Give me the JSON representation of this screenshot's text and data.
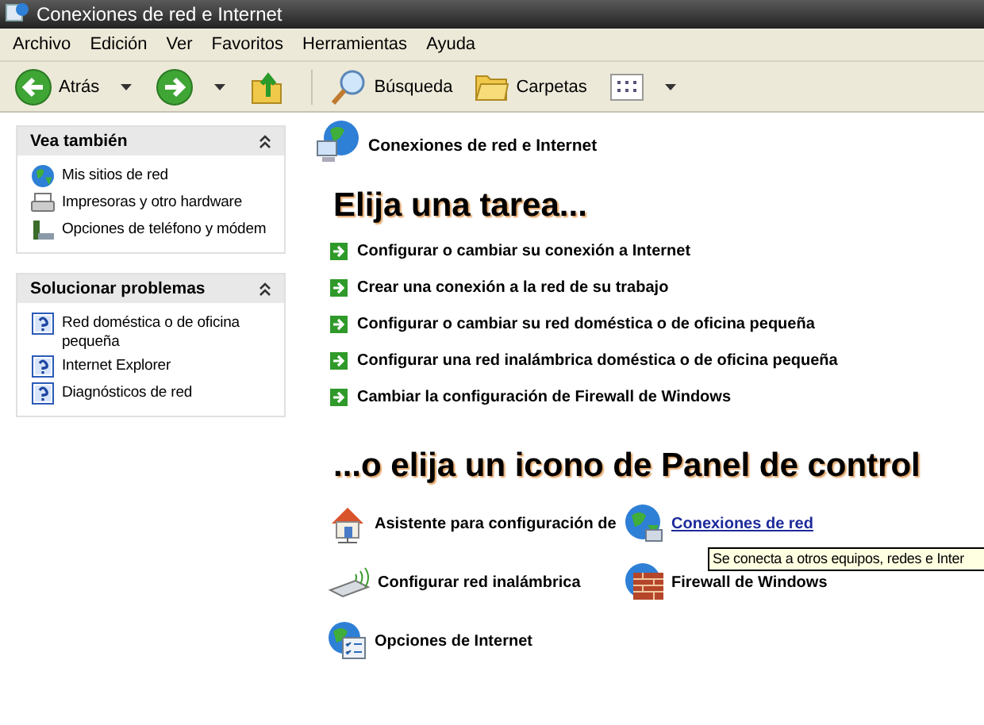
{
  "window": {
    "title": "Conexiones de red e Internet"
  },
  "menu": [
    "Archivo",
    "Edición",
    "Ver",
    "Favoritos",
    "Herramientas",
    "Ayuda"
  ],
  "toolbar": [
    {
      "kind": "back",
      "label": "Atrás"
    },
    {
      "kind": "forward"
    },
    {
      "kind": "up"
    },
    {
      "kind": "search",
      "label": "Búsqueda"
    },
    {
      "kind": "folders",
      "label": "Carpetas"
    },
    {
      "kind": "views"
    }
  ],
  "sidebar": [
    {
      "title": "Vea también",
      "expanded": true,
      "items": [
        {
          "kind": "globe",
          "label": "Mis sitios de red"
        },
        {
          "kind": "printer",
          "label": "Impresoras y otro hardware"
        },
        {
          "kind": "phone",
          "label": "Opciones de teléfono y módem"
        }
      ]
    },
    {
      "title": "Solucionar problemas",
      "expanded": true,
      "items": [
        {
          "kind": "help",
          "label": "Red doméstica o de oficina pequeña"
        },
        {
          "kind": "help",
          "label": "Internet Explorer"
        },
        {
          "kind": "help",
          "label": "Diagnósticos de red"
        }
      ]
    }
  ],
  "category": "Conexiones de red e Internet",
  "task_heading": "Elija una tarea...",
  "tasks": [
    "Configurar o cambiar su conexión a Internet",
    "Crear una conexión a la red de su trabajo",
    "Configurar o cambiar su red doméstica o de oficina pequeña",
    "Configurar una red inalámbrica doméstica o de oficina pequeña",
    "Cambiar la configuración de Firewall de Windows"
  ],
  "icon_heading": "...o elija un icono de Panel de control",
  "icons": [
    {
      "kind": "house",
      "label": "Asistente para configuración de",
      "hovered": false
    },
    {
      "kind": "netglobe",
      "label": "Conexiones de red",
      "hovered": true
    },
    {
      "kind": "wireless",
      "label": "Configurar red inalámbrica",
      "hovered": false
    },
    {
      "kind": "firewall",
      "label": "Firewall de Windows",
      "hovered": false
    },
    {
      "kind": "ieopts",
      "label": "Opciones de Internet",
      "hovered": false
    }
  ],
  "tooltip": "Se conecta a otros equipos, redes e Inter"
}
